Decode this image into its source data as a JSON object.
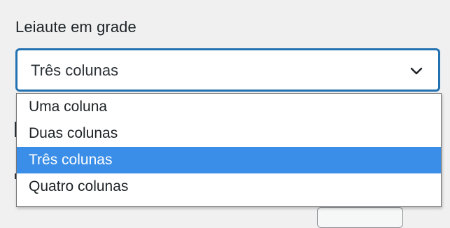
{
  "settings": {
    "label": "Leiaute em grade",
    "select": {
      "value": "Três colunas",
      "options": [
        "Uma coluna",
        "Duas colunas",
        "Três colunas",
        "Quatro colunas"
      ],
      "selected_index": 2
    }
  },
  "colors": {
    "accent": "#2271b1",
    "selected_option": "#3b8ee7",
    "background": "#f0f0f1"
  },
  "icons": {
    "select_chevron": "chevron-down-icon"
  }
}
